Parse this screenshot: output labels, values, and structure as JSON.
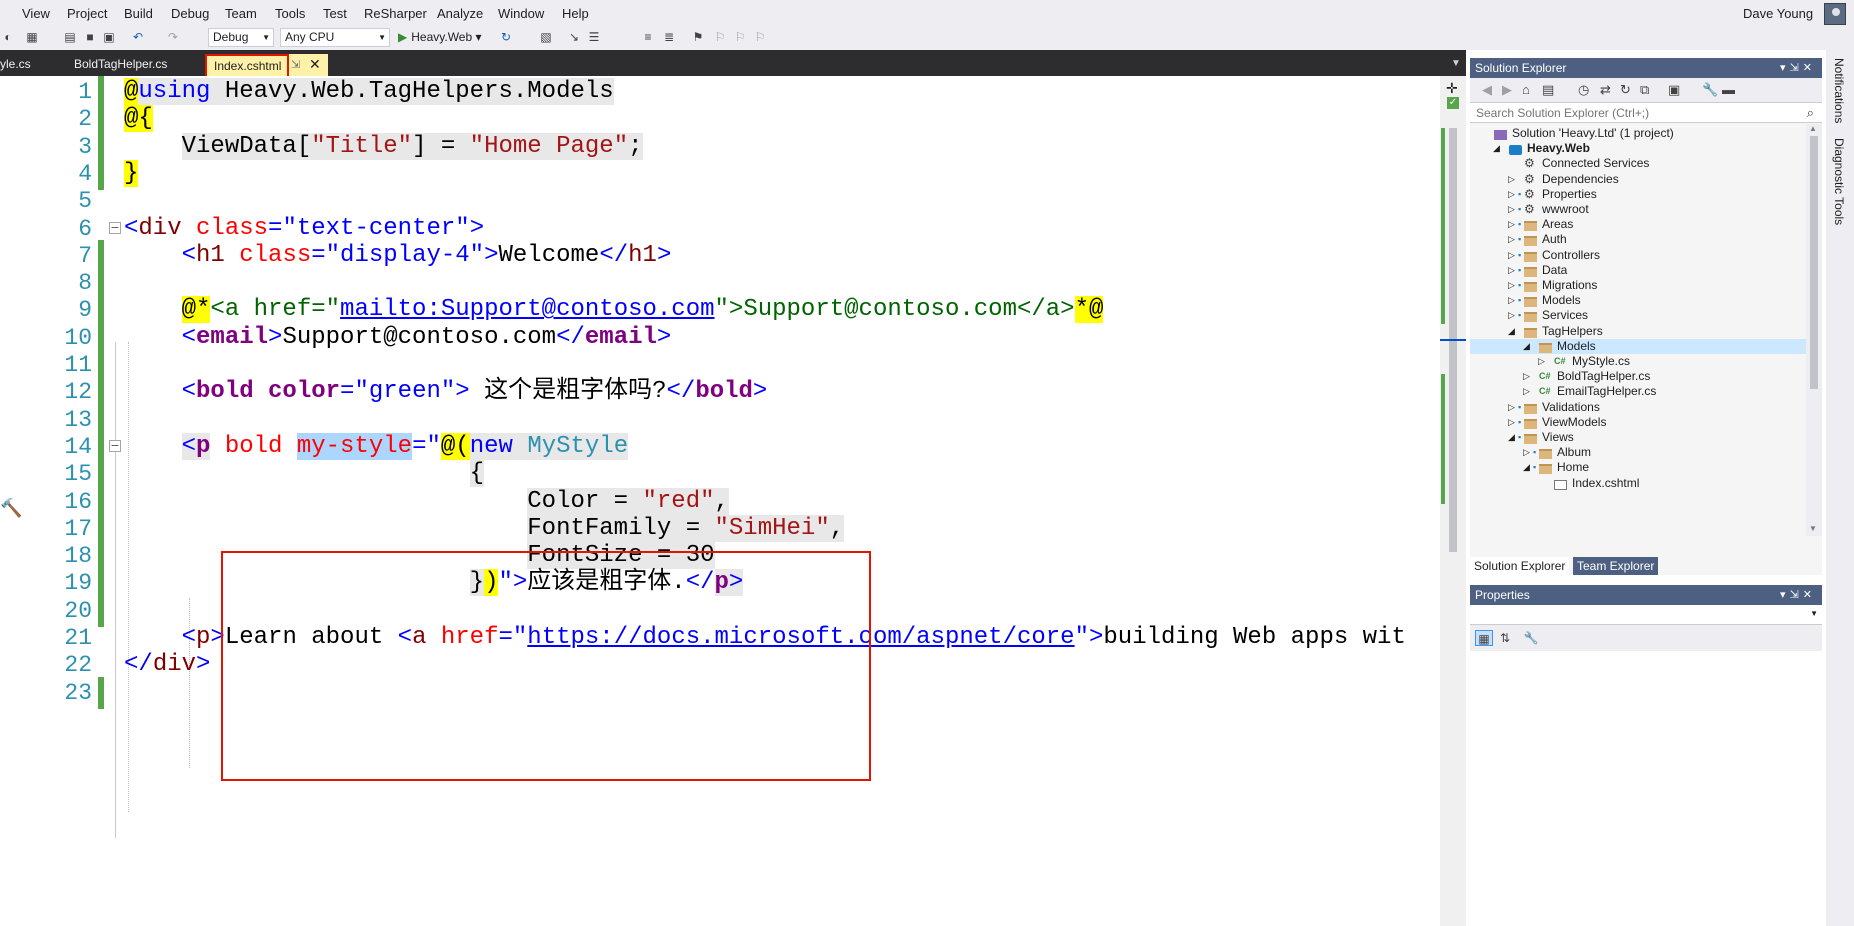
{
  "menu": [
    "View",
    "Project",
    "Build",
    "Debug",
    "Team",
    "Tools",
    "Test",
    "ReSharper",
    "Analyze",
    "Window",
    "Help"
  ],
  "user": {
    "name": "Dave Young"
  },
  "toolbar": {
    "config": "Debug",
    "platform": "Any CPU",
    "run_target": "Heavy.Web"
  },
  "tabs": [
    {
      "label": "yle.cs"
    },
    {
      "label": "BoldTagHelper.cs"
    },
    {
      "label": "Index.cshtml",
      "active": true
    }
  ],
  "editor": {
    "lines": [
      {
        "n": "1",
        "tokens": [
          [
            "@",
            "t-razor"
          ],
          [
            "using",
            "t-kw t-gray"
          ],
          [
            " Heavy.Web.TagHelpers.Models",
            "t-gray"
          ]
        ]
      },
      {
        "n": "2",
        "tokens": [
          [
            "@{",
            "t-razor"
          ]
        ]
      },
      {
        "n": "3",
        "tokens": [
          [
            "    "
          ],
          [
            "ViewData[",
            "t-gray"
          ],
          [
            "\"Title\"",
            "t-str t-gray"
          ],
          [
            "] = ",
            "t-gray"
          ],
          [
            "\"Home Page\"",
            "t-str t-gray"
          ],
          [
            ";",
            "t-gray"
          ]
        ]
      },
      {
        "n": "4",
        "tokens": [
          [
            "}",
            "t-razor"
          ]
        ]
      },
      {
        "n": "5",
        "tokens": []
      },
      {
        "n": "6",
        "tokens": [
          [
            "<",
            "t-kw"
          ],
          [
            "div",
            "t-tag"
          ],
          [
            " class",
            "t-attr"
          ],
          [
            "=",
            "t-kw"
          ],
          [
            "\"text-center\"",
            "t-kw"
          ],
          [
            ">",
            "t-kw"
          ]
        ]
      },
      {
        "n": "7",
        "tokens": [
          [
            "    "
          ],
          [
            "<",
            "t-kw"
          ],
          [
            "h1",
            "t-tag"
          ],
          [
            " class",
            "t-attr"
          ],
          [
            "=",
            "t-kw"
          ],
          [
            "\"display-4\"",
            "t-kw"
          ],
          [
            ">",
            "t-kw"
          ],
          [
            "Welcome"
          ],
          [
            "</",
            "t-kw"
          ],
          [
            "h1",
            "t-tag"
          ],
          [
            ">",
            "t-kw"
          ]
        ]
      },
      {
        "n": "8",
        "tokens": []
      },
      {
        "n": "9",
        "tokens": [
          [
            "    "
          ],
          [
            "@*",
            "t-razor"
          ],
          [
            "<a href=\"",
            "t-green"
          ],
          [
            "mailto:Support@contoso.com",
            "t-link"
          ],
          [
            "\">Support@contoso.com</a>",
            "t-green"
          ],
          [
            "*@",
            "t-razor"
          ]
        ]
      },
      {
        "n": "10",
        "tokens": [
          [
            "    "
          ],
          [
            "<",
            "t-kw"
          ],
          [
            "email",
            "t-bold"
          ],
          [
            ">",
            "t-kw"
          ],
          [
            "Support@contoso.com"
          ],
          [
            "</",
            "t-kw"
          ],
          [
            "email",
            "t-bold"
          ],
          [
            ">",
            "t-kw"
          ]
        ]
      },
      {
        "n": "11",
        "tokens": []
      },
      {
        "n": "12",
        "tokens": [
          [
            "    "
          ],
          [
            "<",
            "t-kw"
          ],
          [
            "bold",
            "t-bold"
          ],
          [
            " color",
            "t-bold"
          ],
          [
            "=",
            "t-kw"
          ],
          [
            "\"green\"",
            "t-kw"
          ],
          [
            ">",
            "t-kw"
          ],
          [
            " 这个是粗字体吗?"
          ],
          [
            "</",
            "t-kw"
          ],
          [
            "bold",
            "t-bold"
          ],
          [
            ">",
            "t-kw"
          ]
        ]
      },
      {
        "n": "13",
        "tokens": []
      },
      {
        "n": "14",
        "tokens": [
          [
            "    "
          ],
          [
            "<",
            "t-kw t-gray"
          ],
          [
            "p",
            "t-bold t-gray"
          ],
          [
            " bold ",
            "t-attr"
          ],
          [
            "my-style",
            "t-attr t-sel"
          ],
          [
            "=\"",
            "t-kw"
          ],
          [
            "@(",
            "t-razor"
          ],
          [
            "new",
            "t-kw t-gray"
          ],
          [
            " ",
            "t-gray"
          ],
          [
            "MyStyle",
            "t-type t-gray"
          ]
        ]
      },
      {
        "n": "15",
        "tokens": [
          [
            "                        "
          ],
          [
            "{",
            "t-gray"
          ]
        ]
      },
      {
        "n": "16",
        "tokens": [
          [
            "                            "
          ],
          [
            "Color = ",
            "t-gray"
          ],
          [
            "\"red\"",
            "t-str t-gray"
          ],
          [
            ",",
            "t-gray"
          ]
        ]
      },
      {
        "n": "17",
        "tokens": [
          [
            "                            "
          ],
          [
            "FontFamily = ",
            "t-gray"
          ],
          [
            "\"SimHei\"",
            "t-str t-gray"
          ],
          [
            ",",
            "t-gray"
          ]
        ]
      },
      {
        "n": "18",
        "tokens": [
          [
            "                            "
          ],
          [
            "FontSize = 30",
            "t-gray"
          ]
        ]
      },
      {
        "n": "19",
        "tokens": [
          [
            "                        "
          ],
          [
            "}",
            "t-gray"
          ],
          [
            ")",
            "t-razor"
          ],
          [
            "\">",
            "t-kw"
          ],
          [
            "应该是粗字体."
          ],
          [
            "</",
            "t-kw"
          ],
          [
            "p",
            "t-bold t-gray"
          ],
          [
            ">",
            "t-kw t-gray"
          ]
        ]
      },
      {
        "n": "20",
        "tokens": []
      },
      {
        "n": "21",
        "tokens": [
          [
            "    "
          ],
          [
            "<",
            "t-kw"
          ],
          [
            "p",
            "t-tag"
          ],
          [
            ">",
            "t-kw"
          ],
          [
            "Learn about "
          ],
          [
            "<",
            "t-kw"
          ],
          [
            "a",
            "t-tag"
          ],
          [
            " href",
            "t-attr"
          ],
          [
            "=",
            "t-kw"
          ],
          [
            "\"",
            "t-kw"
          ],
          [
            "https://docs.microsoft.com/aspnet/core",
            "t-link"
          ],
          [
            "\"",
            "t-kw"
          ],
          [
            ">",
            "t-kw"
          ],
          [
            "building Web apps wit"
          ]
        ]
      },
      {
        "n": "22",
        "tokens": [
          [
            "</",
            "t-kw"
          ],
          [
            "div",
            "t-tag"
          ],
          [
            ">",
            "t-kw"
          ]
        ]
      },
      {
        "n": "23",
        "tokens": []
      }
    ]
  },
  "solution_explorer": {
    "title": "Solution Explorer",
    "search_placeholder": "Search Solution Explorer (Ctrl+;)",
    "tree": [
      {
        "label": "Solution 'Heavy.Ltd' (1 project)",
        "icon": "sln",
        "indent": 0,
        "exp": "",
        "lock": false
      },
      {
        "label": "Heavy.Web",
        "icon": "proj",
        "indent": 1,
        "exp": "◢",
        "lock": false,
        "bold": true
      },
      {
        "label": "Connected Services",
        "icon": "gear",
        "indent": 2,
        "exp": "",
        "lock": false
      },
      {
        "label": "Dependencies",
        "icon": "gear",
        "indent": 2,
        "exp": "▷",
        "lock": false
      },
      {
        "label": "Properties",
        "icon": "gear",
        "indent": 2,
        "exp": "▷",
        "lock": true
      },
      {
        "label": "wwwroot",
        "icon": "gear",
        "indent": 2,
        "exp": "▷",
        "lock": true
      },
      {
        "label": "Areas",
        "icon": "folder",
        "indent": 2,
        "exp": "▷",
        "lock": true
      },
      {
        "label": "Auth",
        "icon": "folder",
        "indent": 2,
        "exp": "▷",
        "lock": true
      },
      {
        "label": "Controllers",
        "icon": "folder",
        "indent": 2,
        "exp": "▷",
        "lock": true
      },
      {
        "label": "Data",
        "icon": "folder",
        "indent": 2,
        "exp": "▷",
        "lock": true
      },
      {
        "label": "Migrations",
        "icon": "folder",
        "indent": 2,
        "exp": "▷",
        "lock": true
      },
      {
        "label": "Models",
        "icon": "folder",
        "indent": 2,
        "exp": "▷",
        "lock": true
      },
      {
        "label": "Services",
        "icon": "folder",
        "indent": 2,
        "exp": "▷",
        "lock": true
      },
      {
        "label": "TagHelpers",
        "icon": "folder",
        "indent": 2,
        "exp": "◢",
        "lock": false
      },
      {
        "label": "Models",
        "icon": "folder",
        "indent": 3,
        "exp": "◢",
        "lock": false,
        "selected": true
      },
      {
        "label": "MyStyle.cs",
        "icon": "cs",
        "indent": 4,
        "exp": "▷",
        "lock": false
      },
      {
        "label": "BoldTagHelper.cs",
        "icon": "cs",
        "indent": 3,
        "exp": "▷",
        "lock": false
      },
      {
        "label": "EmailTagHelper.cs",
        "icon": "cs",
        "indent": 3,
        "exp": "▷",
        "lock": false
      },
      {
        "label": "Validations",
        "icon": "folder",
        "indent": 2,
        "exp": "▷",
        "lock": true
      },
      {
        "label": "ViewModels",
        "icon": "folder",
        "indent": 2,
        "exp": "▷",
        "lock": true
      },
      {
        "label": "Views",
        "icon": "folder",
        "indent": 2,
        "exp": "◢",
        "lock": true
      },
      {
        "label": "Album",
        "icon": "folder",
        "indent": 3,
        "exp": "▷",
        "lock": true
      },
      {
        "label": "Home",
        "icon": "folder",
        "indent": 3,
        "exp": "◢",
        "lock": true
      },
      {
        "label": "Index.cshtml",
        "icon": "page",
        "indent": 4,
        "exp": "",
        "lock": false
      }
    ],
    "tabs": [
      "Solution Explorer",
      "Team Explorer"
    ]
  },
  "properties": {
    "title": "Properties"
  },
  "side_tabs": [
    "Notifications",
    "Diagnostic Tools"
  ],
  "colors": {
    "accent": "#4d6082",
    "highlight_box": "#e51400",
    "tab_bar": "#2d2d30",
    "change_margin": "#57a64a"
  }
}
